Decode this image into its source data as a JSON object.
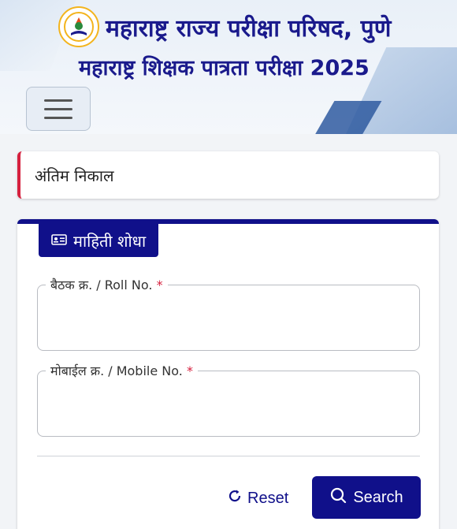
{
  "header": {
    "title_line1": "महाराष्ट्र राज्य परीक्षा परिषद, पुणे",
    "title_line2": "महाराष्ट्र शिक्षक पात्रता परीक्षा 2025",
    "logo_icon": "council-emblem-icon",
    "menu_icon": "hamburger-menu-icon"
  },
  "result_card": {
    "label": "अंतिम निकाल",
    "accent_color": "#d6203e"
  },
  "form": {
    "tab_label": "माहिती शोधा",
    "tab_icon": "id-card-icon",
    "roll_field": {
      "label": "बैठक क्र. / Roll No.",
      "required_mark": "*",
      "value": ""
    },
    "mobile_field": {
      "label": "मोबाईल क्र. / Mobile No.",
      "required_mark": "*",
      "value": ""
    },
    "reset_label": "Reset",
    "reset_icon": "refresh-icon",
    "search_label": "Search",
    "search_icon": "search-icon"
  },
  "colors": {
    "primary": "#10108a",
    "title": "#1a1a8c",
    "required": "#d6203e"
  }
}
